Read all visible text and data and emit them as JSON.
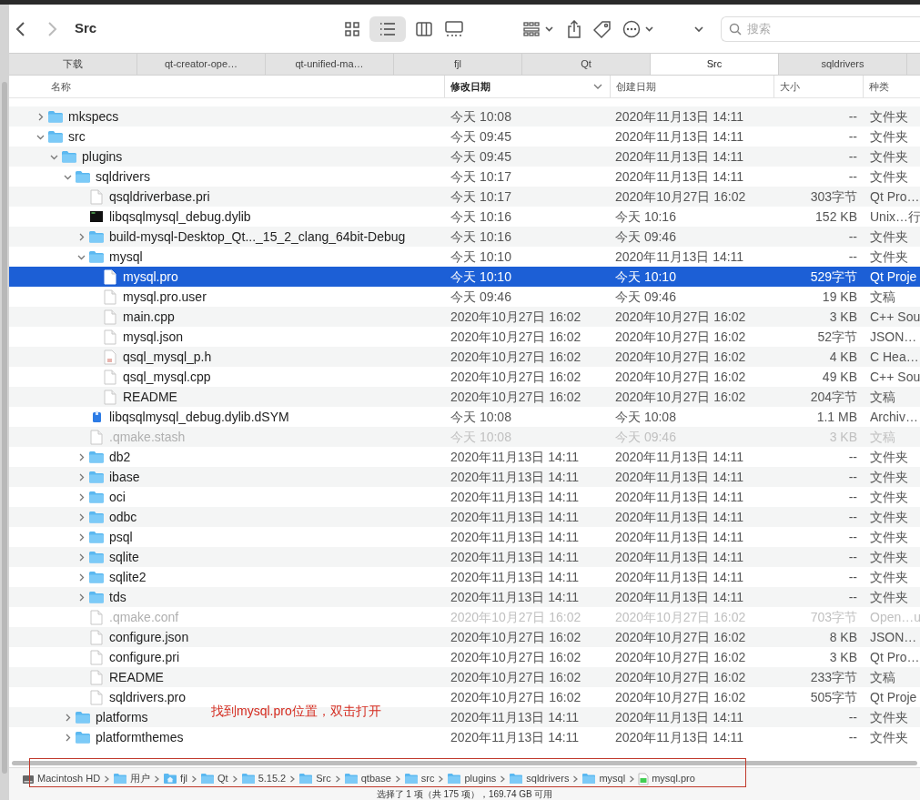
{
  "toolbar": {
    "title": "Src",
    "search": {
      "placeholder": "搜索"
    }
  },
  "tabs": [
    {
      "label": "下载",
      "selected": false
    },
    {
      "label": "qt-creator-ope…",
      "selected": false
    },
    {
      "label": "qt-unified-ma…",
      "selected": false
    },
    {
      "label": "fjl",
      "selected": false
    },
    {
      "label": "Qt",
      "selected": false
    },
    {
      "label": "Src",
      "selected": true
    },
    {
      "label": "sqldrivers",
      "selected": false
    }
  ],
  "columns": [
    {
      "label": "名称",
      "sorted": false
    },
    {
      "label": "修改日期",
      "sorted": true
    },
    {
      "label": "创建日期",
      "sorted": false
    },
    {
      "label": "大小",
      "sorted": false
    },
    {
      "label": "种类",
      "sorted": false
    }
  ],
  "rows": [
    {
      "name": "mkspecs",
      "kind": "folder",
      "expanded": false,
      "selected": false,
      "dimmed": false,
      "modified": "今天 10:08",
      "created": "2020年11月13日 14:11",
      "size": "--",
      "type": "文件夹"
    },
    {
      "name": "src",
      "kind": "folder",
      "expanded": true,
      "selected": false,
      "dimmed": false,
      "modified": "今天 09:45",
      "created": "2020年11月13日 14:11",
      "size": "--",
      "type": "文件夹",
      "children": [
        {
          "name": "plugins",
          "kind": "folder",
          "expanded": true,
          "selected": false,
          "dimmed": false,
          "modified": "今天 09:45",
          "created": "2020年11月13日 14:11",
          "size": "--",
          "type": "文件夹",
          "children": [
            {
              "name": "sqldrivers",
              "kind": "folder",
              "expanded": true,
              "selected": false,
              "dimmed": false,
              "modified": "今天 10:17",
              "created": "2020年11月13日 14:11",
              "size": "--",
              "type": "文件夹",
              "children": [
                {
                  "name": "qsqldriverbase.pri",
                  "kind": "document",
                  "selected": false,
                  "dimmed": false,
                  "modified": "今天 10:17",
                  "created": "2020年10月27日 16:02",
                  "size": "303字节",
                  "type": "Qt Pro…"
                },
                {
                  "name": "libqsqlmysql_debug.dylib",
                  "kind": "executable",
                  "selected": false,
                  "dimmed": false,
                  "modified": "今天 10:16",
                  "created": "今天 10:16",
                  "size": "152 KB",
                  "type": "Unix…行"
                },
                {
                  "name": "build-mysql-Desktop_Qt..._15_2_clang_64bit-Debug",
                  "kind": "folder",
                  "expanded": false,
                  "selected": false,
                  "dimmed": false,
                  "modified": "今天 10:16",
                  "created": "今天 09:46",
                  "size": "--",
                  "type": "文件夹"
                },
                {
                  "name": "mysql",
                  "kind": "folder",
                  "expanded": true,
                  "selected": false,
                  "dimmed": false,
                  "modified": "今天 10:10",
                  "created": "2020年11月13日 14:11",
                  "size": "--",
                  "type": "文件夹",
                  "children": [
                    {
                      "name": "mysql.pro",
                      "kind": "document",
                      "selected": true,
                      "dimmed": false,
                      "modified": "今天 10:10",
                      "created": "今天 10:10",
                      "size": "529字节",
                      "type": "Qt Proje"
                    },
                    {
                      "name": "mysql.pro.user",
                      "kind": "document",
                      "selected": false,
                      "dimmed": false,
                      "modified": "今天 09:46",
                      "created": "今天 09:46",
                      "size": "19 KB",
                      "type": "文稿"
                    },
                    {
                      "name": "main.cpp",
                      "kind": "document",
                      "selected": false,
                      "dimmed": false,
                      "modified": "2020年10月27日 16:02",
                      "created": "2020年10月27日 16:02",
                      "size": "3 KB",
                      "type": "C++ Sou"
                    },
                    {
                      "name": "mysql.json",
                      "kind": "document",
                      "selected": false,
                      "dimmed": false,
                      "modified": "2020年10月27日 16:02",
                      "created": "2020年10月27日 16:02",
                      "size": "52字节",
                      "type": "JSON…"
                    },
                    {
                      "name": "qsql_mysql_p.h",
                      "kind": "header",
                      "selected": false,
                      "dimmed": false,
                      "modified": "2020年10月27日 16:02",
                      "created": "2020年10月27日 16:02",
                      "size": "4 KB",
                      "type": "C Hea…"
                    },
                    {
                      "name": "qsql_mysql.cpp",
                      "kind": "document",
                      "selected": false,
                      "dimmed": false,
                      "modified": "2020年10月27日 16:02",
                      "created": "2020年10月27日 16:02",
                      "size": "49 KB",
                      "type": "C++ Sou"
                    },
                    {
                      "name": "README",
                      "kind": "document",
                      "selected": false,
                      "dimmed": false,
                      "modified": "2020年10月27日 16:02",
                      "created": "2020年10月27日 16:02",
                      "size": "204字节",
                      "type": "文稿"
                    }
                  ]
                },
                {
                  "name": "libqsqlmysql_debug.dylib.dSYM",
                  "kind": "archive",
                  "selected": false,
                  "dimmed": false,
                  "modified": "今天 10:08",
                  "created": "今天 10:08",
                  "size": "1.1 MB",
                  "type": "Archiv…"
                },
                {
                  "name": ".qmake.stash",
                  "kind": "document",
                  "selected": false,
                  "dimmed": true,
                  "modified": "今天 10:08",
                  "created": "今天 09:46",
                  "size": "3 KB",
                  "type": "文稿"
                },
                {
                  "name": "db2",
                  "kind": "folder",
                  "expanded": false,
                  "selected": false,
                  "dimmed": false,
                  "modified": "2020年11月13日 14:11",
                  "created": "2020年11月13日 14:11",
                  "size": "--",
                  "type": "文件夹"
                },
                {
                  "name": "ibase",
                  "kind": "folder",
                  "expanded": false,
                  "selected": false,
                  "dimmed": false,
                  "modified": "2020年11月13日 14:11",
                  "created": "2020年11月13日 14:11",
                  "size": "--",
                  "type": "文件夹"
                },
                {
                  "name": "oci",
                  "kind": "folder",
                  "expanded": false,
                  "selected": false,
                  "dimmed": false,
                  "modified": "2020年11月13日 14:11",
                  "created": "2020年11月13日 14:11",
                  "size": "--",
                  "type": "文件夹"
                },
                {
                  "name": "odbc",
                  "kind": "folder",
                  "expanded": false,
                  "selected": false,
                  "dimmed": false,
                  "modified": "2020年11月13日 14:11",
                  "created": "2020年11月13日 14:11",
                  "size": "--",
                  "type": "文件夹"
                },
                {
                  "name": "psql",
                  "kind": "folder",
                  "expanded": false,
                  "selected": false,
                  "dimmed": false,
                  "modified": "2020年11月13日 14:11",
                  "created": "2020年11月13日 14:11",
                  "size": "--",
                  "type": "文件夹"
                },
                {
                  "name": "sqlite",
                  "kind": "folder",
                  "expanded": false,
                  "selected": false,
                  "dimmed": false,
                  "modified": "2020年11月13日 14:11",
                  "created": "2020年11月13日 14:11",
                  "size": "--",
                  "type": "文件夹"
                },
                {
                  "name": "sqlite2",
                  "kind": "folder",
                  "expanded": false,
                  "selected": false,
                  "dimmed": false,
                  "modified": "2020年11月13日 14:11",
                  "created": "2020年11月13日 14:11",
                  "size": "--",
                  "type": "文件夹"
                },
                {
                  "name": "tds",
                  "kind": "folder",
                  "expanded": false,
                  "selected": false,
                  "dimmed": false,
                  "modified": "2020年11月13日 14:11",
                  "created": "2020年11月13日 14:11",
                  "size": "--",
                  "type": "文件夹"
                },
                {
                  "name": ".qmake.conf",
                  "kind": "document",
                  "selected": false,
                  "dimmed": true,
                  "modified": "2020年10月27日 16:02",
                  "created": "2020年10月27日 16:02",
                  "size": "703字节",
                  "type": "Open…u"
                },
                {
                  "name": "configure.json",
                  "kind": "document",
                  "selected": false,
                  "dimmed": false,
                  "modified": "2020年10月27日 16:02",
                  "created": "2020年10月27日 16:02",
                  "size": "8 KB",
                  "type": "JSON…"
                },
                {
                  "name": "configure.pri",
                  "kind": "document",
                  "selected": false,
                  "dimmed": false,
                  "modified": "2020年10月27日 16:02",
                  "created": "2020年10月27日 16:02",
                  "size": "3 KB",
                  "type": "Qt Pro…"
                },
                {
                  "name": "README",
                  "kind": "document",
                  "selected": false,
                  "dimmed": false,
                  "modified": "2020年10月27日 16:02",
                  "created": "2020年10月27日 16:02",
                  "size": "233字节",
                  "type": "文稿"
                },
                {
                  "name": "sqldrivers.pro",
                  "kind": "document",
                  "selected": false,
                  "dimmed": false,
                  "modified": "2020年10月27日 16:02",
                  "created": "2020年10月27日 16:02",
                  "size": "505字节",
                  "type": "Qt Proje"
                }
              ]
            },
            {
              "name": "platforms",
              "kind": "folder",
              "expanded": false,
              "selected": false,
              "dimmed": false,
              "modified": "2020年11月13日 14:11",
              "created": "2020年11月13日 14:11",
              "size": "--",
              "type": "文件夹"
            },
            {
              "name": "platformthemes",
              "kind": "folder",
              "expanded": false,
              "selected": false,
              "dimmed": false,
              "modified": "2020年11月13日 14:11",
              "created": "2020年11月13日 14:11",
              "size": "--",
              "type": "文件夹"
            }
          ]
        }
      ]
    }
  ],
  "annotation": "找到mysql.pro位置，双击打开",
  "path_bar": [
    {
      "label": "Macintosh HD",
      "kind": "disk"
    },
    {
      "label": "用户",
      "kind": "folder"
    },
    {
      "label": "fjl",
      "kind": "home"
    },
    {
      "label": "Qt",
      "kind": "folder"
    },
    {
      "label": "5.15.2",
      "kind": "folder"
    },
    {
      "label": "Src",
      "kind": "folder"
    },
    {
      "label": "qtbase",
      "kind": "folder"
    },
    {
      "label": "src",
      "kind": "folder"
    },
    {
      "label": "plugins",
      "kind": "folder"
    },
    {
      "label": "sqldrivers",
      "kind": "folder"
    },
    {
      "label": "mysql",
      "kind": "folder"
    },
    {
      "label": "mysql.pro",
      "kind": "qtfile"
    }
  ],
  "status_bar": "选择了 1 项（共 175 项），169.74 GB 可用"
}
